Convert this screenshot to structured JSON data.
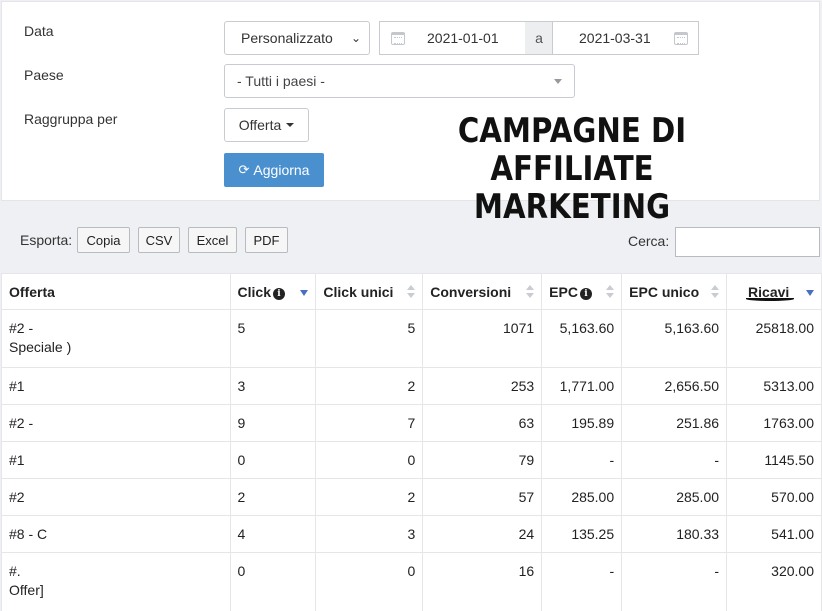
{
  "filters": {
    "date_label": "Data",
    "period_select": "Personalizzato",
    "date_from": "2021-01-01",
    "date_separator": "a",
    "date_to": "2021-03-31",
    "country_label": "Paese",
    "country_select": "- Tutti i paesi -",
    "group_label": "Raggruppa per",
    "group_button": "Offerta",
    "refresh_button": "Aggiorna"
  },
  "headline": {
    "line1": "CAMPAGNE DI",
    "line2": "AFFILIATE MARKETING"
  },
  "toolbar": {
    "export_label": "Esporta:",
    "export_buttons": [
      "Copia",
      "CSV",
      "Excel",
      "PDF"
    ],
    "search_label": "Cerca:"
  },
  "table": {
    "columns": [
      "Offerta",
      "Click",
      "Click unici",
      "Conversioni",
      "EPC",
      "EPC unico",
      "Ricavi"
    ],
    "rows": [
      {
        "offerta_1": "#2       -",
        "offerta_2": "Speciale )",
        "click": "5",
        "click_unici": "5",
        "conversioni": "1071",
        "epc": "5,163.60",
        "epc_unico": "5,163.60",
        "ricavi": "25818.00"
      },
      {
        "offerta_1": "#1",
        "offerta_2": "",
        "click": "3",
        "click_unici": "2",
        "conversioni": "253",
        "epc": "1,771.00",
        "epc_unico": "2,656.50",
        "ricavi": "5313.00"
      },
      {
        "offerta_1": "#2      -",
        "offerta_2": "",
        "click": "9",
        "click_unici": "7",
        "conversioni": "63",
        "epc": "195.89",
        "epc_unico": "251.86",
        "ricavi": "1763.00"
      },
      {
        "offerta_1": "#1",
        "offerta_2": "",
        "click": "0",
        "click_unici": "0",
        "conversioni": "79",
        "epc": "-",
        "epc_unico": "-",
        "ricavi": "1145.50"
      },
      {
        "offerta_1": "#2",
        "offerta_2": "",
        "click": "2",
        "click_unici": "2",
        "conversioni": "57",
        "epc": "285.00",
        "epc_unico": "285.00",
        "ricavi": "570.00"
      },
      {
        "offerta_1": "#8 - C",
        "offerta_2": "",
        "click": "4",
        "click_unici": "3",
        "conversioni": "24",
        "epc": "135.25",
        "epc_unico": "180.33",
        "ricavi": "541.00"
      },
      {
        "offerta_1": "#.",
        "offerta_2": "Offer]",
        "click": "0",
        "click_unici": "0",
        "conversioni": "16",
        "epc": "-",
        "epc_unico": "-",
        "ricavi": "320.00"
      }
    ]
  }
}
